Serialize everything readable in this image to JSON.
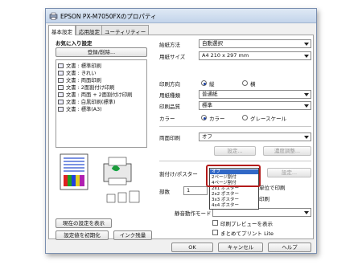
{
  "window": {
    "title": "EPSON PX-M7050FXのプロパティ"
  },
  "tabs": [
    {
      "label": "基本設定"
    },
    {
      "label": "応用設定"
    },
    {
      "label": "ユーティリティー"
    }
  ],
  "favorites": {
    "heading": "お気に入り設定",
    "register_button": "登録/削除...",
    "items": [
      {
        "label": "文書 : 標準印刷"
      },
      {
        "label": "文書 : きれい"
      },
      {
        "label": "文書 : 両面印刷"
      },
      {
        "label": "文書 : 2面割付け印刷"
      },
      {
        "label": "文書 : 両面 + 2面割付け印刷"
      },
      {
        "label": "文書 : 白黒印刷(標準)"
      },
      {
        "label": "文書 : 標準(A3)"
      }
    ]
  },
  "settings": {
    "paper_source_label": "給紙方法",
    "paper_source_value": "自動選択",
    "paper_size_label": "用紙サイズ",
    "paper_size_value": "A4 210 x 297 mm",
    "orientation_label": "印刷方向",
    "orientation_portrait": "縦",
    "orientation_landscape": "横",
    "paper_type_label": "用紙種類",
    "paper_type_value": "普通紙",
    "quality_label": "印刷品質",
    "quality_value": "標準",
    "color_label": "カラー",
    "color_option": "カラー",
    "grayscale_option": "グレースケール",
    "duplex_label": "両面印刷",
    "duplex_value": "オフ",
    "duplex_settings_button": "設定...",
    "density_button": "濃度調整...",
    "layout_label": "割付け/ポスター",
    "layout_value": "オフ",
    "layout_settings_button": "設定...",
    "layout_options": [
      "オフ",
      "2ページ割付",
      "4ページ割付",
      "2x1 ポスター",
      "2x2 ポスター",
      "3x3 ポスター",
      "4x4 ポスター"
    ],
    "copies_label": "部数",
    "copies_value": "1",
    "collate_partial": "単位で印刷",
    "reverse_partial": "印刷",
    "quiet_mode_label": "静音動作モード",
    "preview_label": "印刷プレビューを表示",
    "lite_label": "まとめてプリント Lite"
  },
  "buttons": {
    "show_settings": "現在の設定を表示",
    "reset": "設定値を初期化",
    "ink_level": "インク残量",
    "ok": "OK",
    "cancel": "キャンセル",
    "help": "ヘルプ"
  }
}
